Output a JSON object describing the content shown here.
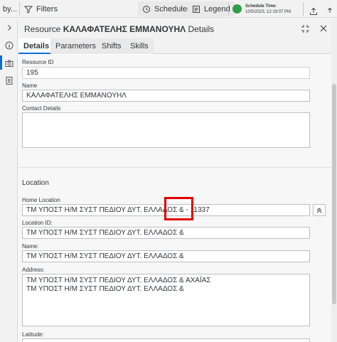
{
  "toolbar": {
    "truncated_label": "by...",
    "filters_label": "Filters",
    "schedules_label": "Schedules",
    "legend_label": "Legend",
    "schedule_time_title": "Schedule Time:",
    "schedule_time_value": "10/5/2023, 12:19:07 PM"
  },
  "panel": {
    "title_prefix": "Resource",
    "title_name": "ΚΑΛΑΦΑΤΕΛΗΣ ΕΜΜΑΝΟΥΗΛ",
    "title_suffix": "Details",
    "tabs": [
      {
        "label": "Details",
        "active": true
      },
      {
        "label": "Parameters",
        "active": false
      },
      {
        "label": "Shifts",
        "active": false
      },
      {
        "label": "Skills",
        "active": false
      }
    ]
  },
  "form": {
    "resource_id_label": "Resource ID",
    "resource_id_value": "195",
    "name_label": "Name",
    "name_value": "ΚΑΛΑΦΑΤΕΛΗΣ ΕΜΜΑΝΟΥΗΛ",
    "contact_label": "Contact Details",
    "contact_value": "",
    "location_section": "Location",
    "home_location_label": "Home Location",
    "home_location_value": "ΤΜ ΥΠΟΣΤ Η/Μ ΣΥΣΤ ΠΕΔΙΟΥ ΔΥΤ. ΕΛΛΑΔΟΣ & - 11337",
    "location_id_label": "Location ID:",
    "location_id_value": "ΤΜ ΥΠΟΣΤ Η/Μ ΣΥΣΤ ΠΕΔΙΟΥ ΔΥΤ. ΕΛΛΑΔΟΣ &",
    "loc_name_label": "Name:",
    "loc_name_value": "ΤΜ ΥΠΟΣΤ Η/Μ ΣΥΣΤ ΠΕΔΙΟΥ ΔΥΤ. ΕΛΛΑΔΟΣ &",
    "address_label": "Address:",
    "address_line1": "ΤΜ ΥΠΟΣΤ Η/Μ ΣΥΣΤ ΠΕΔΙΟΥ ΔΥΤ. ΕΛΛΑΔΟΣ & ΑΧΑΪΑΣ",
    "address_line2": "ΤΜ ΥΠΟΣΤ Η/Μ ΣΥΣΤ ΠΕΔΙΟΥ ΔΥΤ. ΕΛΛΑΔΟΣ &",
    "latitude_label": "Latitude:"
  },
  "colors": {
    "accent": "#0a6ed1",
    "status_green": "#2ea04b",
    "highlight_red": "#e10000"
  },
  "icons": [
    "filter-icon",
    "calendar-icon",
    "legend-icon",
    "export-icon",
    "chevron-right-icon",
    "info-icon",
    "camera-icon",
    "clipboard-icon",
    "collapse-icon",
    "close-icon",
    "chevron-up-icon"
  ]
}
